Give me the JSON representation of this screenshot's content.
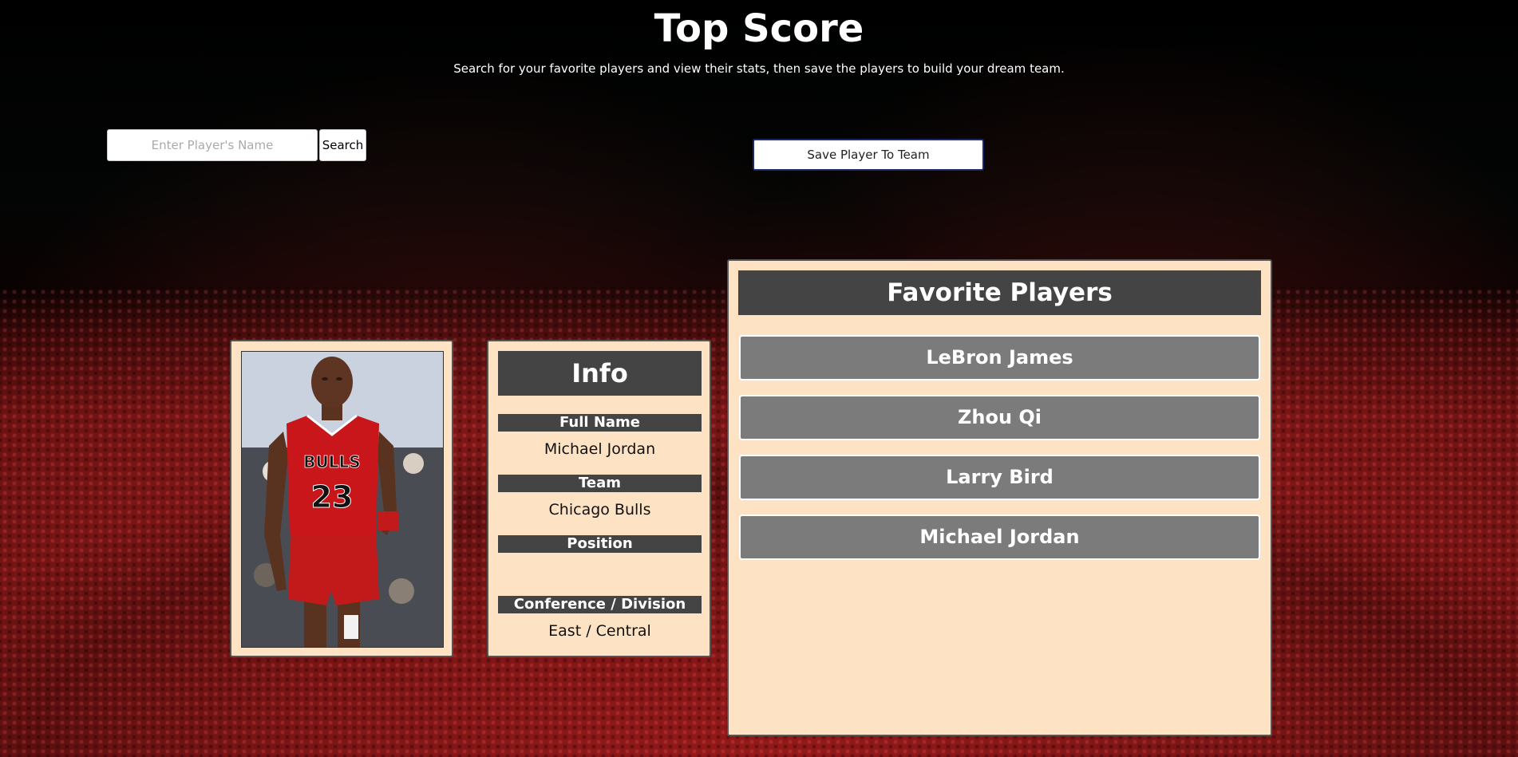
{
  "header": {
    "title": "Top Score",
    "subtitle": "Search for your favorite players and view their stats, then save the players to build your dream team."
  },
  "search": {
    "placeholder": "Enter Player's Name",
    "value": "",
    "button_label": "Search"
  },
  "actions": {
    "save_label": "Save Player To Team"
  },
  "player": {
    "photo_alt": "Michael Jordan",
    "jersey_team": "BULLS",
    "jersey_number": "23"
  },
  "info": {
    "heading": "Info",
    "fields": [
      {
        "label": "Full Name",
        "value": "Michael Jordan"
      },
      {
        "label": "Team",
        "value": "Chicago Bulls"
      },
      {
        "label": "Position",
        "value": ""
      },
      {
        "label": "Conference / Division",
        "value": "East / Central"
      }
    ]
  },
  "favorites": {
    "heading": "Favorite Players",
    "players": [
      "LeBron James",
      "Zhou Qi",
      "Larry Bird",
      "Michael Jordan"
    ]
  },
  "colors": {
    "card_background": "#fde3c4",
    "heading_background": "#444444",
    "favorite_item_background": "#7b7b7b",
    "save_button_border": "#1d2a6b"
  }
}
